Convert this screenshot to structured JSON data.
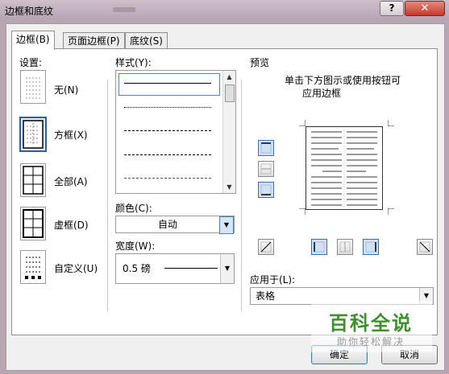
{
  "window": {
    "title": "边框和底纹",
    "help_label": "?",
    "close_label": "✕"
  },
  "tabs": [
    {
      "label": "边框(B)",
      "active": true
    },
    {
      "label": "页面边框(P)",
      "active": false
    },
    {
      "label": "底纹(S)",
      "active": false
    }
  ],
  "settings": {
    "heading": "设置:",
    "items": [
      {
        "label": "无(N)",
        "icon": "no-border-icon"
      },
      {
        "label": "方框(X)",
        "icon": "box-border-icon",
        "selected": true
      },
      {
        "label": "全部(A)",
        "icon": "all-borders-icon"
      },
      {
        "label": "虚框(D)",
        "icon": "grid-border-icon"
      },
      {
        "label": "自定义(U)",
        "icon": "custom-border-icon"
      }
    ]
  },
  "style": {
    "heading": "样式(Y):",
    "options": [
      "solid",
      "dotted",
      "dashed-fine",
      "dashed",
      "dash-dot"
    ],
    "selected": "solid"
  },
  "color": {
    "label": "颜色(C):",
    "value": "自动"
  },
  "width": {
    "label": "宽度(W):",
    "value": "0.5 磅"
  },
  "preview": {
    "heading": "预览",
    "hint_line1": "单击下方图示或使用按钮可",
    "hint_line2": "应用边框"
  },
  "apply_to": {
    "label": "应用于(L):",
    "value": "表格"
  },
  "buttons": {
    "ok": "确定",
    "cancel": "取消"
  },
  "watermark": {
    "title": "百科全说",
    "subtitle": "助你轻松解决"
  },
  "colors": {
    "selection_blue": "#2f5fa0",
    "preview_lines": "#9a9a9a",
    "watermark_green": "#3f8f2f"
  }
}
